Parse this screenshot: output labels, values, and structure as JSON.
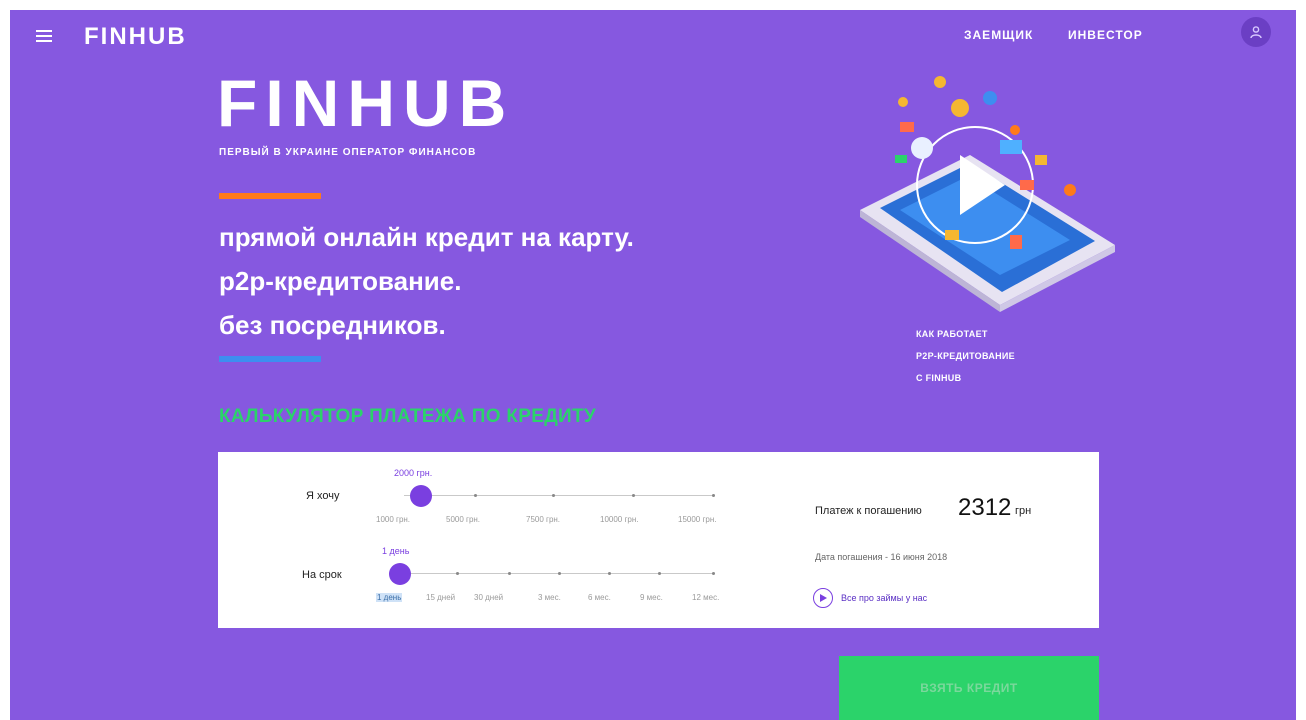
{
  "topbar": {
    "logo": "FINHUB",
    "nav": [
      {
        "label": "ЗАЕМЩИК"
      },
      {
        "label": "ИНВЕСТОР"
      }
    ]
  },
  "hero": {
    "logo": "FINHUB",
    "subtitle": "ПЕРВЫЙ В УКРАИНЕ ОПЕРАТОР ФИНАНСОВ",
    "taglines": [
      "прямой онлайн кредит на карту.",
      "p2p-кредитование.",
      "без посредников."
    ]
  },
  "video": {
    "caption_lines": [
      "КАК РАБОТАЕТ",
      "P2P-КРЕДИТОВАНИЕ",
      "С FINHUB"
    ]
  },
  "calculator": {
    "title": "КАЛЬКУЛЯТОР ПЛАТЕЖА ПО КРЕДИТУ",
    "amount": {
      "label": "Я хочу",
      "value_text": "2000 грн.",
      "ticks": [
        "1000 грн.",
        "5000 грн.",
        "7500 грн.",
        "10000 грн.",
        "15000 грн."
      ]
    },
    "term": {
      "label": "На срок",
      "value_text": "1 день",
      "ticks": [
        "1 день",
        "15 дней",
        "30 дней",
        "3 мес.",
        "6 мес.",
        "9 мес.",
        "12 мес."
      ]
    },
    "payment_label": "Платеж к погашению",
    "payment_amount": "2312",
    "payment_unit": "грн",
    "due_date": "Дата погашения - 16 июня 2018",
    "loans_link": "Все про займы у нас"
  },
  "cta": {
    "label": "ВЗЯТЬ КРЕДИТ"
  },
  "colors": {
    "background": "#8658e0",
    "orange_accent": "#ff7a1a",
    "blue_accent": "#3d8ef0",
    "calc_title": "#2bd36a",
    "cta": "#2bd36a",
    "slider": "#7a3fe0"
  },
  "icons": {
    "menu": "hamburger-icon",
    "avatar": "user-icon",
    "play": "play-icon"
  }
}
